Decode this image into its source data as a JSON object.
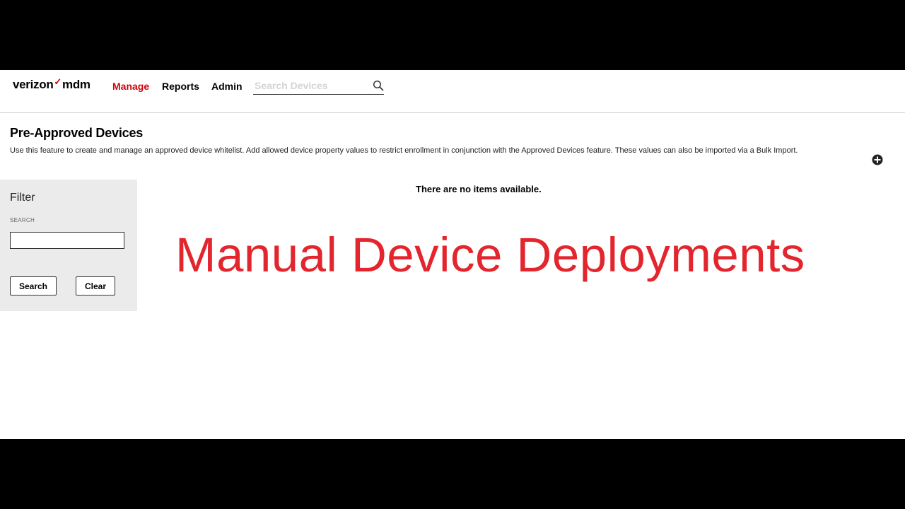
{
  "brand": {
    "name": "verizon",
    "check": "✓",
    "product": "mdm"
  },
  "nav": [
    {
      "label": "Manage",
      "active": true
    },
    {
      "label": "Reports",
      "active": false
    },
    {
      "label": "Admin",
      "active": false
    }
  ],
  "search": {
    "placeholder": "Search Devices",
    "value": "",
    "icon": "search-icon"
  },
  "page": {
    "title": "Pre-Approved Devices",
    "description": "Use this feature to create and manage an approved device whitelist. Add allowed device property values to restrict enrollment in conjunction with the Approved Devices feature. These values can also be imported via a Bulk Import.",
    "add_icon": "plus-circle-icon"
  },
  "filter": {
    "title": "Filter",
    "search_label": "SEARCH",
    "search_value": "",
    "search_button": "Search",
    "clear_button": "Clear"
  },
  "empty_state": "There are no items available.",
  "overlay_title": "Manual Device Deployments",
  "colors": {
    "brand_red": "#cd040b",
    "overlay_red": "#e3262e",
    "panel_bg": "#ebebeb"
  }
}
